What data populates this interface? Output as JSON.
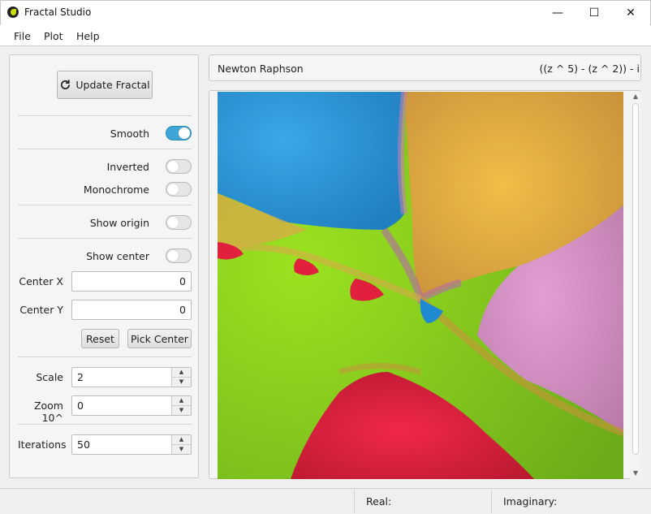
{
  "window": {
    "title": "Fractal Studio",
    "minimize_glyph": "—",
    "maximize_glyph": "☐",
    "close_glyph": "✕"
  },
  "menu": [
    "File",
    "Plot",
    "Help"
  ],
  "controls": {
    "update_label": "Update Fractal",
    "update_icon": "refresh-icon",
    "smooth_label": "Smooth",
    "smooth_on": true,
    "inverted_label": "Inverted",
    "inverted_on": false,
    "monochrome_label": "Monochrome",
    "monochrome_on": false,
    "show_origin_label": "Show origin",
    "show_origin_on": false,
    "show_center_label": "Show center",
    "show_center_on": false,
    "center_x_label": "Center X",
    "center_x_value": "0",
    "center_y_label": "Center Y",
    "center_y_value": "0",
    "reset_label": "Reset",
    "pick_center_label": "Pick Center",
    "scale_label": "Scale",
    "scale_value": "2",
    "zoom_label": "Zoom 10^",
    "zoom_value": "0",
    "iterations_label": "Iterations",
    "iterations_value": "50"
  },
  "fractal": {
    "name": "Newton Raphson",
    "formula": "((z ^ 5) - (z ^ 2)) - i",
    "colors": {
      "blue": "#2a8fd0",
      "gold": "#e0aa40",
      "pink": "#d592c4",
      "green": "#8fd21e",
      "red": "#e0203c"
    }
  },
  "status": {
    "real_label": "Real:",
    "imaginary_label": "Imaginary:"
  }
}
